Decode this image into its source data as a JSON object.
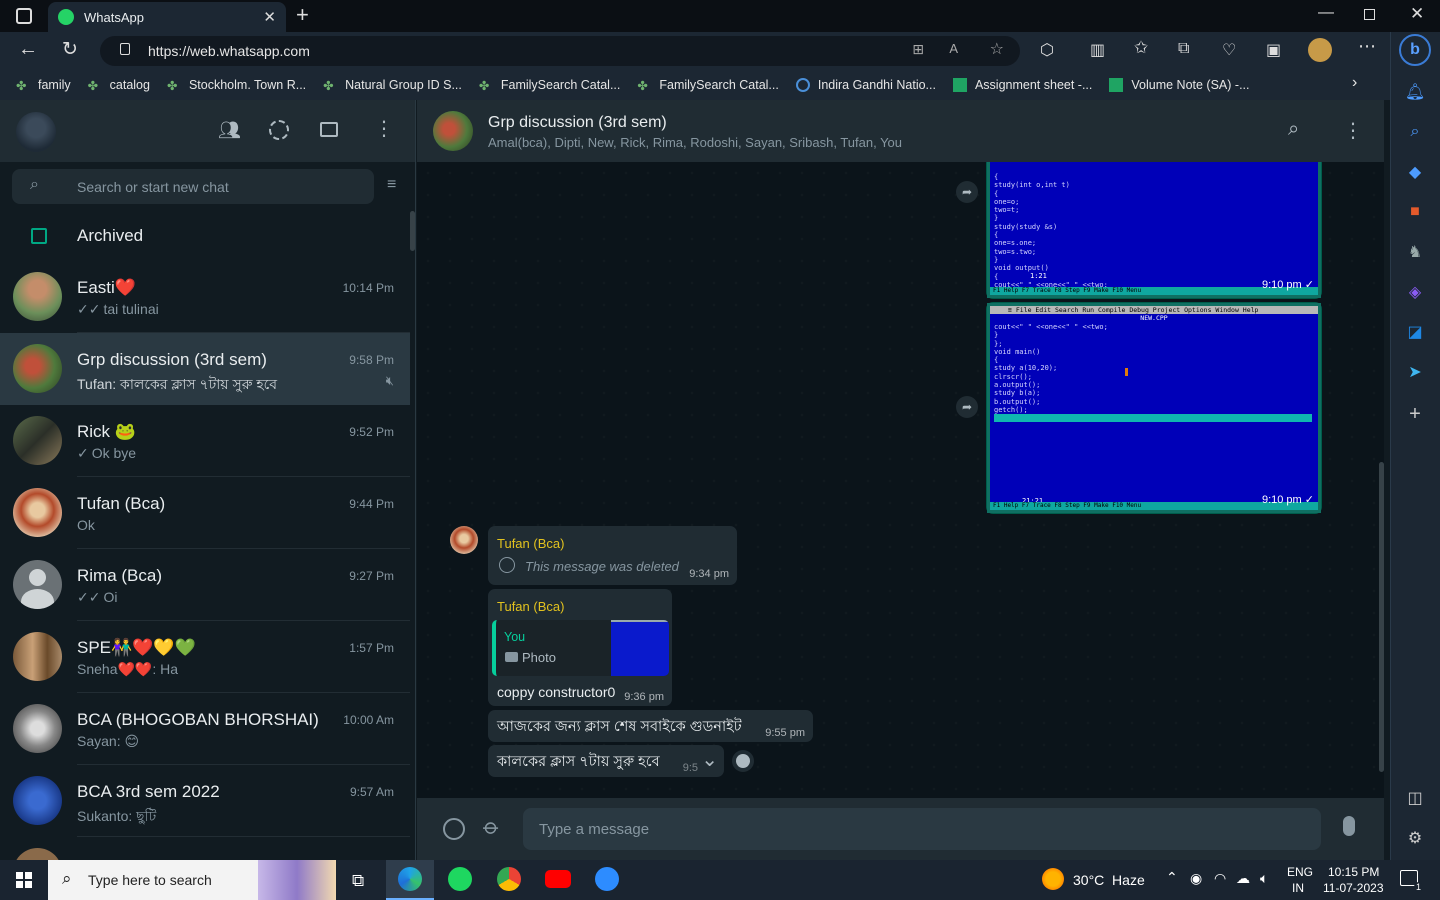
{
  "browser": {
    "tab_title": "WhatsApp",
    "url": "https://web.whatsapp.com",
    "bookmarks": [
      "family",
      "catalog",
      "Stockholm. Town R...",
      "Natural Group ID S...",
      "FamilySearch Catal...",
      "FamilySearch Catal...",
      "Indira Gandhi Natio...",
      "Assignment sheet -...",
      "Volume Note (SA) -..."
    ]
  },
  "left": {
    "search_placeholder": "Search or start new chat",
    "archived_label": "Archived",
    "chats": [
      {
        "name": "Easti❤️",
        "time": "10:14 Pm",
        "preview": "tai tulinai",
        "ticks": "✓✓"
      },
      {
        "name": "Grp discussion (3rd sem)",
        "time": "9:58 Pm",
        "preview": "Tufan: কালকের ক্লাস ৭টায় সুরু হবে",
        "ticks": ""
      },
      {
        "name": "Rick 🐸",
        "time": "9:52 Pm",
        "preview": "Ok bye",
        "ticks": "✓"
      },
      {
        "name": "Tufan (Bca)",
        "time": "9:44 Pm",
        "preview": "Ok",
        "ticks": ""
      },
      {
        "name": "Rima (Bca)",
        "time": "9:27 Pm",
        "preview": "Oi",
        "ticks": "✓✓"
      },
      {
        "name": "SPE👫❤️💛💚",
        "time": "1:57 Pm",
        "preview": "Sneha❤️❤️: Ha",
        "ticks": ""
      },
      {
        "name": "BCA (BHOGOBAN BHORSHAI)",
        "time": "10:00 Am",
        "preview": "Sayan: 😊",
        "ticks": ""
      },
      {
        "name": "BCA 3rd sem 2022",
        "time": "9:57 Am",
        "preview": "Sukanto: ছুটি",
        "ticks": ""
      }
    ]
  },
  "conversation": {
    "title": "Grp discussion (3rd sem)",
    "members": "Amal(bca), Dipti, New, Rick, Rima, Rodoshi, Sayan, Sribash, Tufan, You",
    "img1_time": "9:10 pm",
    "img2_time": "9:10 pm",
    "img1_status": "1:21",
    "img2_status": "21:21",
    "img2_menu": "≡  File  Edit  Search  Run  Compile  Debug  Project  Options   Window  Help",
    "img2_filename": "NEW.CPP",
    "img_footer": "F1 Help  F7 Trace  F8 Step  F9 Make  F10 Menu",
    "msg_deleted_sender": "Tufan (Bca)",
    "msg_deleted_text": "This message was deleted",
    "msg_deleted_time": "9:34 pm",
    "msg_reply_sender": "Tufan (Bca)",
    "msg_reply_quote_author": "You",
    "msg_reply_quote_text": "Photo",
    "msg_reply_text": "coppy constructor0",
    "msg_reply_time": "9:36 pm",
    "msg3_text": "আজকের জন্য ক্লাস শেষ সবাইকে গুডনাইট",
    "msg3_time": "9:55 pm",
    "msg4_text": "কালকের ক্লাস ৭টায় সুরু হবে",
    "msg4_time": "9:5",
    "composer_placeholder": "Type a message"
  },
  "taskbar": {
    "search_placeholder": "Type here to search",
    "weather": "30°C  Haze",
    "lang1": "ENG",
    "lang2": "IN",
    "clock_time": "10:15 PM",
    "clock_date": "11-07-2023",
    "notif_count": "1"
  },
  "colors": {
    "accent_green": "#00a884",
    "sender_yellow": "#e2c21f",
    "panel": "#202c33"
  }
}
